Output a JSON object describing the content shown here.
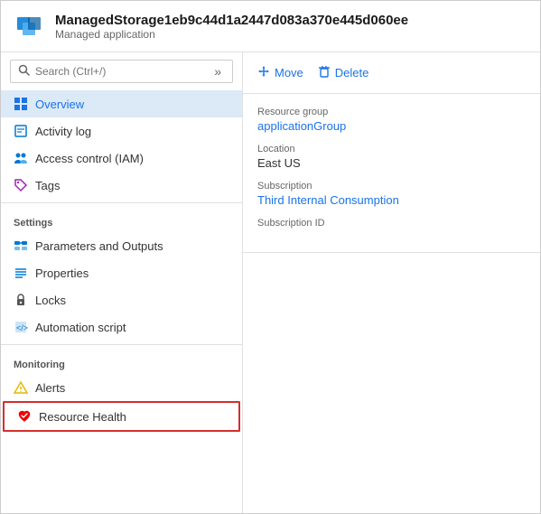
{
  "header": {
    "title": "ManagedStorage1eb9c44d1a2447d083a370e445d060ee",
    "subtitle": "Managed application"
  },
  "search": {
    "placeholder": "Search (Ctrl+/)"
  },
  "sidebar": {
    "nav_items": [
      {
        "id": "overview",
        "label": "Overview",
        "icon": "overview",
        "active": true,
        "section": null
      },
      {
        "id": "activity-log",
        "label": "Activity log",
        "icon": "activity-log",
        "active": false,
        "section": null
      },
      {
        "id": "access-control",
        "label": "Access control (IAM)",
        "icon": "access-control",
        "active": false,
        "section": null
      },
      {
        "id": "tags",
        "label": "Tags",
        "icon": "tags",
        "active": false,
        "section": null
      }
    ],
    "sections": [
      {
        "label": "Settings",
        "items": [
          {
            "id": "parameters",
            "label": "Parameters and Outputs",
            "icon": "parameters"
          },
          {
            "id": "properties",
            "label": "Properties",
            "icon": "properties"
          },
          {
            "id": "locks",
            "label": "Locks",
            "icon": "locks"
          },
          {
            "id": "automation",
            "label": "Automation script",
            "icon": "automation"
          }
        ]
      },
      {
        "label": "Monitoring",
        "items": [
          {
            "id": "alerts",
            "label": "Alerts",
            "icon": "alerts"
          },
          {
            "id": "resource-health",
            "label": "Resource Health",
            "icon": "resource-health",
            "highlighted": true
          }
        ]
      }
    ]
  },
  "toolbar": {
    "move_label": "Move",
    "delete_label": "Delete"
  },
  "info": {
    "resource_group_label": "Resource group",
    "resource_group_value": "applicationGroup",
    "location_label": "Location",
    "location_value": "East US",
    "subscription_label": "Subscription",
    "subscription_value": "Third Internal Consumption",
    "subscription_id_label": "Subscription ID",
    "subscription_id_value": ""
  },
  "colors": {
    "link": "#1a73e8",
    "active_bg": "#dce9f7",
    "highlight_border": "#d32f2f"
  }
}
